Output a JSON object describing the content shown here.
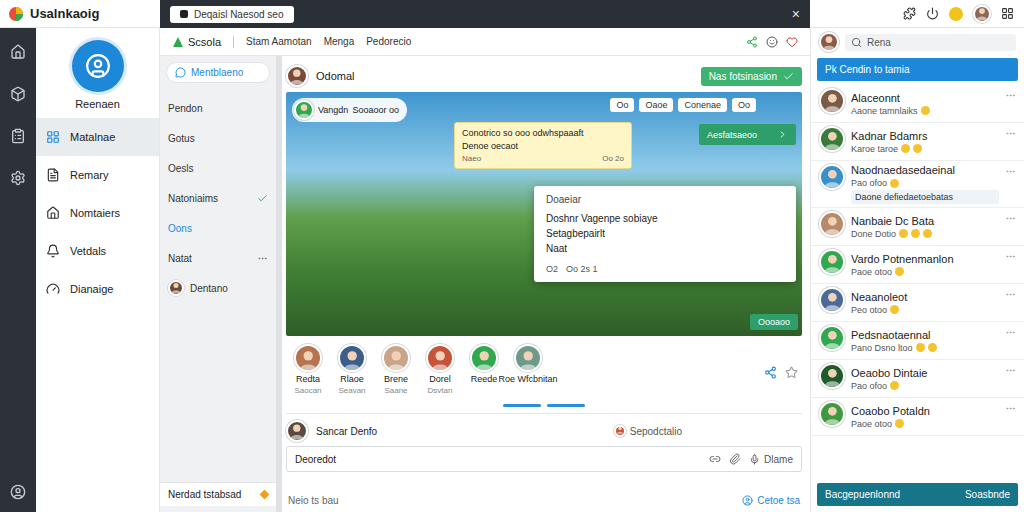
{
  "app": {
    "title": "Usalnkaoig",
    "tab": "Deqaisl Naesod seo",
    "close": "×"
  },
  "profile": {
    "name": "Reenaen"
  },
  "nav": [
    {
      "label": "Matalnae",
      "selected": true
    },
    {
      "label": "Remary",
      "selected": false
    },
    {
      "label": "Nomtaiers",
      "selected": false
    },
    {
      "label": "Vetdals",
      "selected": false
    },
    {
      "label": "Dianaige",
      "selected": false
    }
  ],
  "header": {
    "title": "Scsola",
    "tabs": [
      {
        "label": "Stam Aamotan",
        "selected": false
      },
      {
        "label": "Menga",
        "selected": false
      },
      {
        "label": "Pedorecio",
        "selected": false
      }
    ]
  },
  "channels": {
    "title": "Mentblaeno",
    "items": [
      {
        "label": "Pendon",
        "kind": "plain"
      },
      {
        "label": "Gotus",
        "kind": "plain"
      },
      {
        "label": "Oesls",
        "kind": "plain"
      },
      {
        "label": "Natoniaims",
        "kind": "toggle"
      },
      {
        "label": "Oons",
        "kind": "link"
      },
      {
        "label": "Natat",
        "kind": "more"
      },
      {
        "label": "Dentano",
        "kind": "avatar"
      }
    ],
    "footer": "Nerdad tstabsad"
  },
  "post": {
    "author": "Odomal",
    "follow": "Nas fotsinasion"
  },
  "game": {
    "player": "Vangdn",
    "player_tag": "Sooaoor oo",
    "pills": [
      "Oo",
      "Oaoe",
      "Conenae",
      "Oo"
    ],
    "banner": "Aesfatsaeoo",
    "tooltip": {
      "text": "Conotrico so ooo odwhspaaaft",
      "sub": "Denoe oecaot",
      "meta": "Naeo",
      "time": "Oo 2o"
    },
    "popup": {
      "title": "Doaeiar",
      "lines": [
        "Doshnr Vagenpe sobiaye",
        "Setagbepairlt"
      ],
      "label": "Naat",
      "count": "O2",
      "stats": "Oo 2s 1"
    },
    "action": "Oooaoo"
  },
  "participants": [
    {
      "name": "Redta",
      "sub": "Saocan",
      "color": "#b5734f"
    },
    {
      "name": "Rlaoe",
      "sub": "Seavan",
      "color": "#3b5f8a"
    },
    {
      "name": "Brene",
      "sub": "Saane",
      "color": "#c8a58a"
    },
    {
      "name": "Dorel",
      "sub": "Dsvtan",
      "color": "#c4553a"
    },
    {
      "name": "Reede",
      "color": "#2fa84f"
    },
    {
      "name": "Roe Wfcbnitan",
      "color": "#6f9a8a"
    }
  ],
  "comment": {
    "author": "Sancar Denfo",
    "meta": "Sepodctalio",
    "placeholder": "Deoredot",
    "action": "Dlame"
  },
  "footer": {
    "left": "Neio ts bau",
    "right": "Cetoe tsa"
  },
  "right": {
    "search": "Rena",
    "header": "Pk Cendin to tamia",
    "contacts": [
      {
        "name": "Alaceonnt",
        "message": "Aaone tamnlaiks",
        "reactions": 1,
        "color": "#7a5a48"
      },
      {
        "name": "Kadnar Bdamrs",
        "message": "Karoe taroe",
        "reactions": 2,
        "color": "#3a7a3a"
      },
      {
        "name": "Naodnaedasedaeinal",
        "message": "Pao ofoo",
        "reply": "Daone defiedaetoebatas",
        "reactions": 1,
        "color": "#3a8fc9"
      },
      {
        "name": "Nanbaie Dc Bata",
        "message": "Done Dotio",
        "reactions": 3,
        "color": "#b88a6a"
      },
      {
        "name": "Vardo Potnenmanlon",
        "message": "Paoe otoo",
        "reactions": 1,
        "color": "#2fa84f"
      },
      {
        "name": "Neaanoleot",
        "message": "Peo otoo",
        "reactions": 1,
        "color": "#4a6a9a"
      },
      {
        "name": "Pedsnaotaennal",
        "message": "Pano Dsno ltoo",
        "reactions": 2,
        "color": "#2fa84f"
      },
      {
        "name": "Oeaobo Dintaie",
        "message": "Pao ofoo",
        "reactions": 1,
        "color": "#1f5a2a"
      },
      {
        "name": "Coaobo Potaldn",
        "message": "Paoe otoo",
        "reactions": 1,
        "color": "#3f9a3f"
      }
    ],
    "buttons": [
      "Bacgepuenlonnd",
      "Soasbnde"
    ]
  }
}
